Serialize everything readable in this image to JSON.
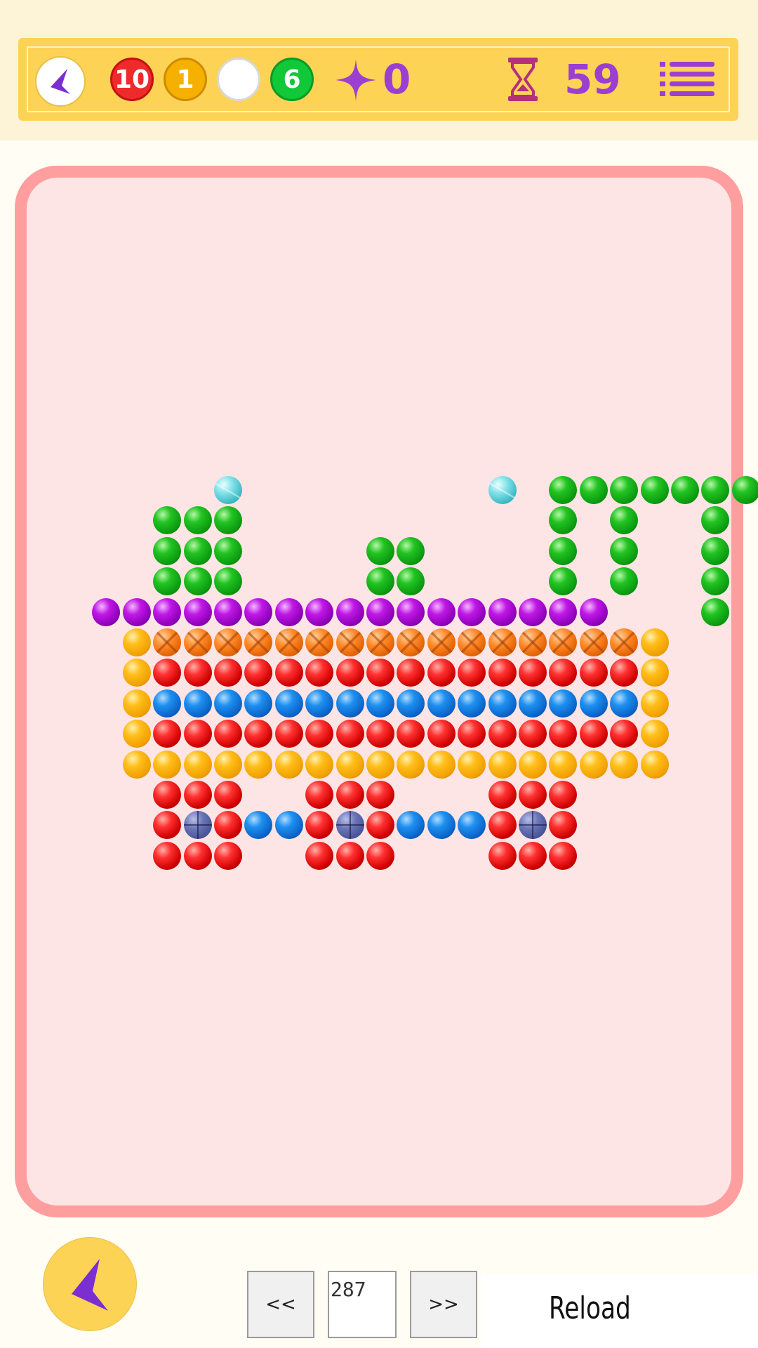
{
  "hud": {
    "counters": [
      {
        "value": "10",
        "color": "#ee2a2a",
        "ring": "#c41010",
        "text": "#ffffff"
      },
      {
        "value": "1",
        "color": "#f5b000",
        "ring": "#d08a00",
        "text": "#ffffff"
      },
      {
        "value": "",
        "color": "#ffffff",
        "ring": "#d8d8d8",
        "text": "#ffffff"
      },
      {
        "value": "6",
        "color": "#10c838",
        "ring": "#0a9a28",
        "text": "#ffffff"
      }
    ],
    "star_count": "0",
    "timer": "59"
  },
  "board": {
    "colors": {
      "R": "red",
      "G": "green",
      "B": "blue",
      "P": "purple",
      "Y": "yellow",
      "O": "orange",
      "C": "cyan",
      "N": "navy"
    },
    "rows": [
      ".....C........C.GGGGGGG",
      "...GGG..........G.G..G.",
      "...GGG....GG....G.G..G.",
      "...GGG....GG....G.G..G.",
      ".PPPPPPPPPPPPPPPPP...G.",
      "..YOOOOOOOOOOOOOOOOY...",
      "..YRRRRRRRRRRRRRRRRY...",
      "..YBBBBBBBBBBBBBBBBY...",
      "..YRRRRRRRRRRRRRRRRY...",
      "..YYYYYYYYYYYYYYYYYY...",
      "...RRR..RRR...RRR......",
      "...RNRBBRNRBBBRNR......",
      "...RRR..RRR...RRR......"
    ]
  },
  "footer": {
    "prev_label": "<<",
    "level": "287",
    "next_label": ">>",
    "reload_label": "Reload"
  }
}
